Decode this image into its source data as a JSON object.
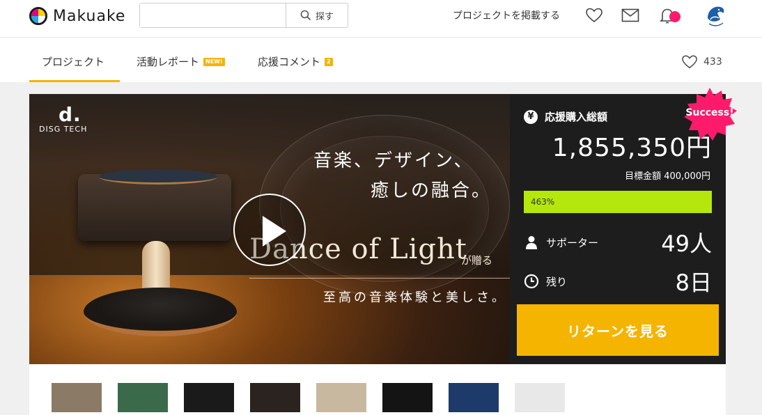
{
  "header": {
    "logo_text": "Makuake",
    "search_placeholder": "",
    "search_button": "探す",
    "post_project": "プロジェクトを掲載する",
    "icons": [
      "heart-icon",
      "mail-icon",
      "bell-icon",
      "avatar"
    ]
  },
  "tabs": {
    "project": "プロジェクト",
    "report": "活動レポート",
    "report_badge": "NEW!",
    "comment": "応援コメント",
    "comment_badge": "2",
    "favorite_count": "433"
  },
  "hero": {
    "brand": "DISG TECH",
    "brand_mark": "d.",
    "catch_line1": "音楽、デザイン、",
    "catch_line2": "癒しの融合。",
    "title_en": "Dance of Light",
    "title_suffix": "が贈る",
    "catch_line3": "至高の音楽体験と美しさ。"
  },
  "panel": {
    "total_label": "応援購入総額",
    "amount": "1,855,350円",
    "target": "目標金額 400,000円",
    "progress_percent": 100,
    "progress_label": "463%",
    "supporters_label": "サポーター",
    "supporters_value": "49人",
    "remaining_label": "残り",
    "remaining_value": "8日",
    "cta": "リターンを見る",
    "success_badge": "Success!"
  },
  "colors": {
    "accent": "#f5b400",
    "progress": "#b4e80c",
    "notification": "#ff1a6c",
    "panel_bg": "#1d1d1d"
  },
  "thumbnails": [
    {
      "name": "thumb-1",
      "bg": "#8a7a66"
    },
    {
      "name": "thumb-2",
      "bg": "#3a6a4a"
    },
    {
      "name": "thumb-3",
      "bg": "#1a1a1a"
    },
    {
      "name": "thumb-4",
      "bg": "#2a2320"
    },
    {
      "name": "thumb-5",
      "bg": "#c9b8a0"
    },
    {
      "name": "thumb-6",
      "bg": "#141414"
    },
    {
      "name": "thumb-7",
      "bg": "#1e3a6a"
    },
    {
      "name": "thumb-8",
      "bg": "#e8e8e8"
    }
  ]
}
